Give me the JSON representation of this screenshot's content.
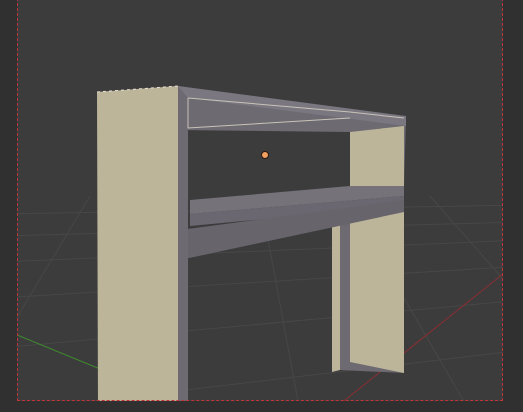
{
  "viewport": {
    "background_color": "#3c3c3c",
    "camera_frame_color": "#c0353a",
    "grid_color": "#4a4a4a",
    "x_axis_color": "#8a2e33",
    "y_axis_color": "#3f8a2e",
    "selection_origin_color": "#f0a060"
  },
  "object": {
    "front_face_color": "#bdb59a",
    "body_color": "#6d6a72",
    "body_dark_color": "#5e5b63",
    "edge_highlight_color": "#c9c3b8"
  }
}
